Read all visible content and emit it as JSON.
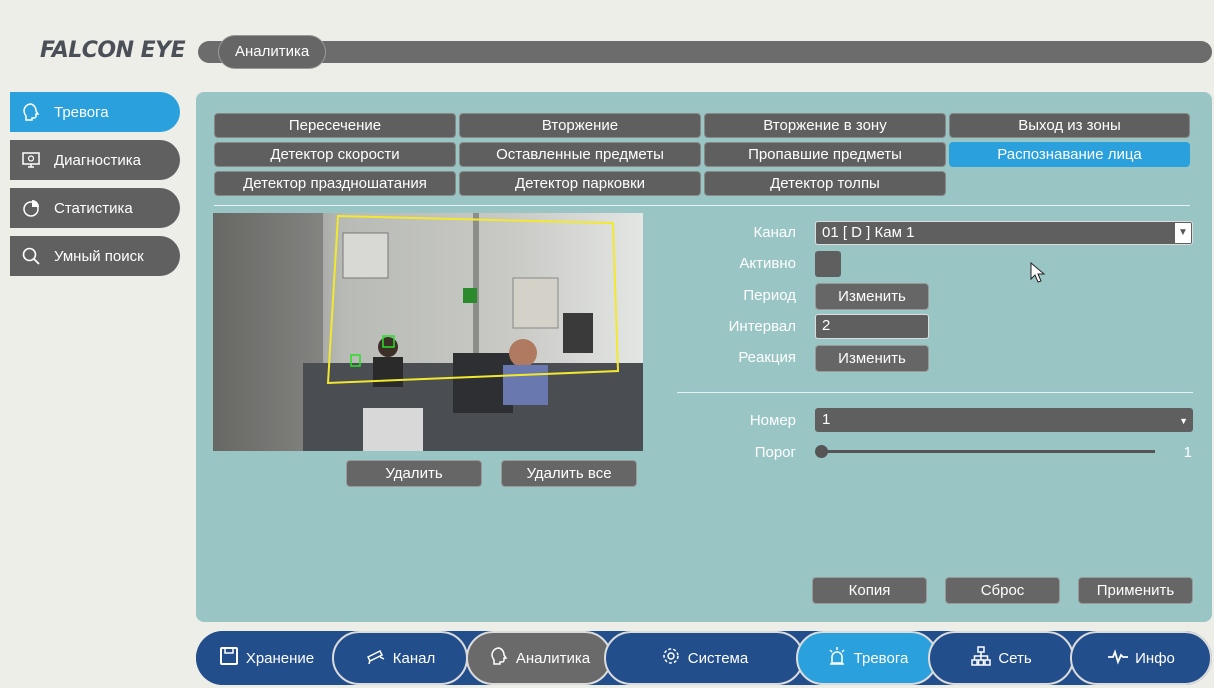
{
  "brand": {
    "logo_text": "FALCON EYE"
  },
  "header": {
    "tab": "Аналитика"
  },
  "sidebar": {
    "items": [
      {
        "label": "Тревога",
        "icon": "head-icon",
        "active": true
      },
      {
        "label": "Диагностика",
        "icon": "monitor-icon",
        "active": false
      },
      {
        "label": "Статистика",
        "icon": "pie-chart-icon",
        "active": false
      },
      {
        "label": "Умный поиск",
        "icon": "search-icon",
        "active": false
      }
    ]
  },
  "tabs": {
    "row1": [
      "Пересечение",
      "Вторжение",
      "Вторжение в зону",
      "Выход из зоны"
    ],
    "row2": [
      "Детектор скорости",
      "Оставленные предметы",
      "Пропавшие предметы",
      "Распознавание лица"
    ],
    "row3": [
      "Детектор праздношатания",
      "Детектор парковки",
      "Детектор толпы"
    ],
    "selected": "Распознавание лица"
  },
  "video": {
    "buttons": {
      "delete": "Удалить",
      "delete_all": "Удалить все"
    }
  },
  "form": {
    "channel_label": "Канал",
    "channel_value": "01 [ D ] Кам 1",
    "active_label": "Активно",
    "active_checked": false,
    "period_label": "Период",
    "period_button": "Изменить",
    "interval_label": "Интервал",
    "interval_value": "2",
    "reaction_label": "Реакция",
    "reaction_button": "Изменить",
    "number_label": "Номер",
    "number_value": "1",
    "threshold_label": "Порог",
    "threshold_value": "1"
  },
  "actions": {
    "copy": "Копия",
    "reset": "Сброс",
    "apply": "Применить"
  },
  "bottom_nav": {
    "items": [
      {
        "label": "Хранение",
        "icon": "save-icon"
      },
      {
        "label": "Канал",
        "icon": "camera-icon"
      },
      {
        "label": "Аналитика",
        "icon": "head-icon"
      },
      {
        "label": "Система",
        "icon": "gear-icon"
      },
      {
        "label": "Тревога",
        "icon": "alarm-icon"
      },
      {
        "label": "Сеть",
        "icon": "network-icon"
      },
      {
        "label": "Инфо",
        "icon": "pulse-icon"
      }
    ]
  },
  "colors": {
    "accent": "#2aa0dc",
    "panel": "#99c5c5",
    "nav": "#234e8c",
    "button": "#5f5f5f"
  }
}
